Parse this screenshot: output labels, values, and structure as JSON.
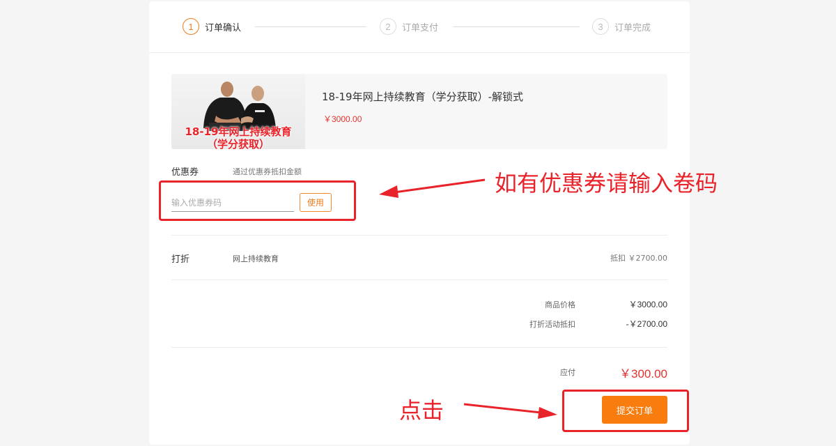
{
  "steps": [
    {
      "number": "1",
      "label": "订单确认",
      "active": true
    },
    {
      "number": "2",
      "label": "订单支付",
      "active": false
    },
    {
      "number": "3",
      "label": "订单完成",
      "active": false
    }
  ],
  "product": {
    "image_caption_line1": "18-19年网上持续教育",
    "image_caption_line2": "（学分获取）",
    "title": "18-19年网上持续教育（学分获取）-解锁式",
    "price": "￥3000.00"
  },
  "coupon": {
    "label": "优惠券",
    "hint": "通过优惠券抵扣金额",
    "placeholder": "输入优惠券码",
    "value": "",
    "use_button": "使用"
  },
  "discount": {
    "label": "打折",
    "name": "网上持续教育",
    "amount": "抵扣 ￥2700.00"
  },
  "summary": {
    "goods_price_label": "商品价格",
    "goods_price_value": "￥3000.00",
    "discount_label": "打折活动抵扣",
    "discount_value": "-￥2700.00",
    "due_label": "应付",
    "due_value": "￥300.00",
    "submit_button": "提交订单"
  },
  "annotations": {
    "coupon_note": "如有优惠券请输入卷码",
    "click_note": "点击"
  },
  "colors": {
    "accent": "#f07c1b",
    "price_red": "#e2332e",
    "annotation_red": "#e8232a",
    "submit_orange": "#f87c0e"
  }
}
